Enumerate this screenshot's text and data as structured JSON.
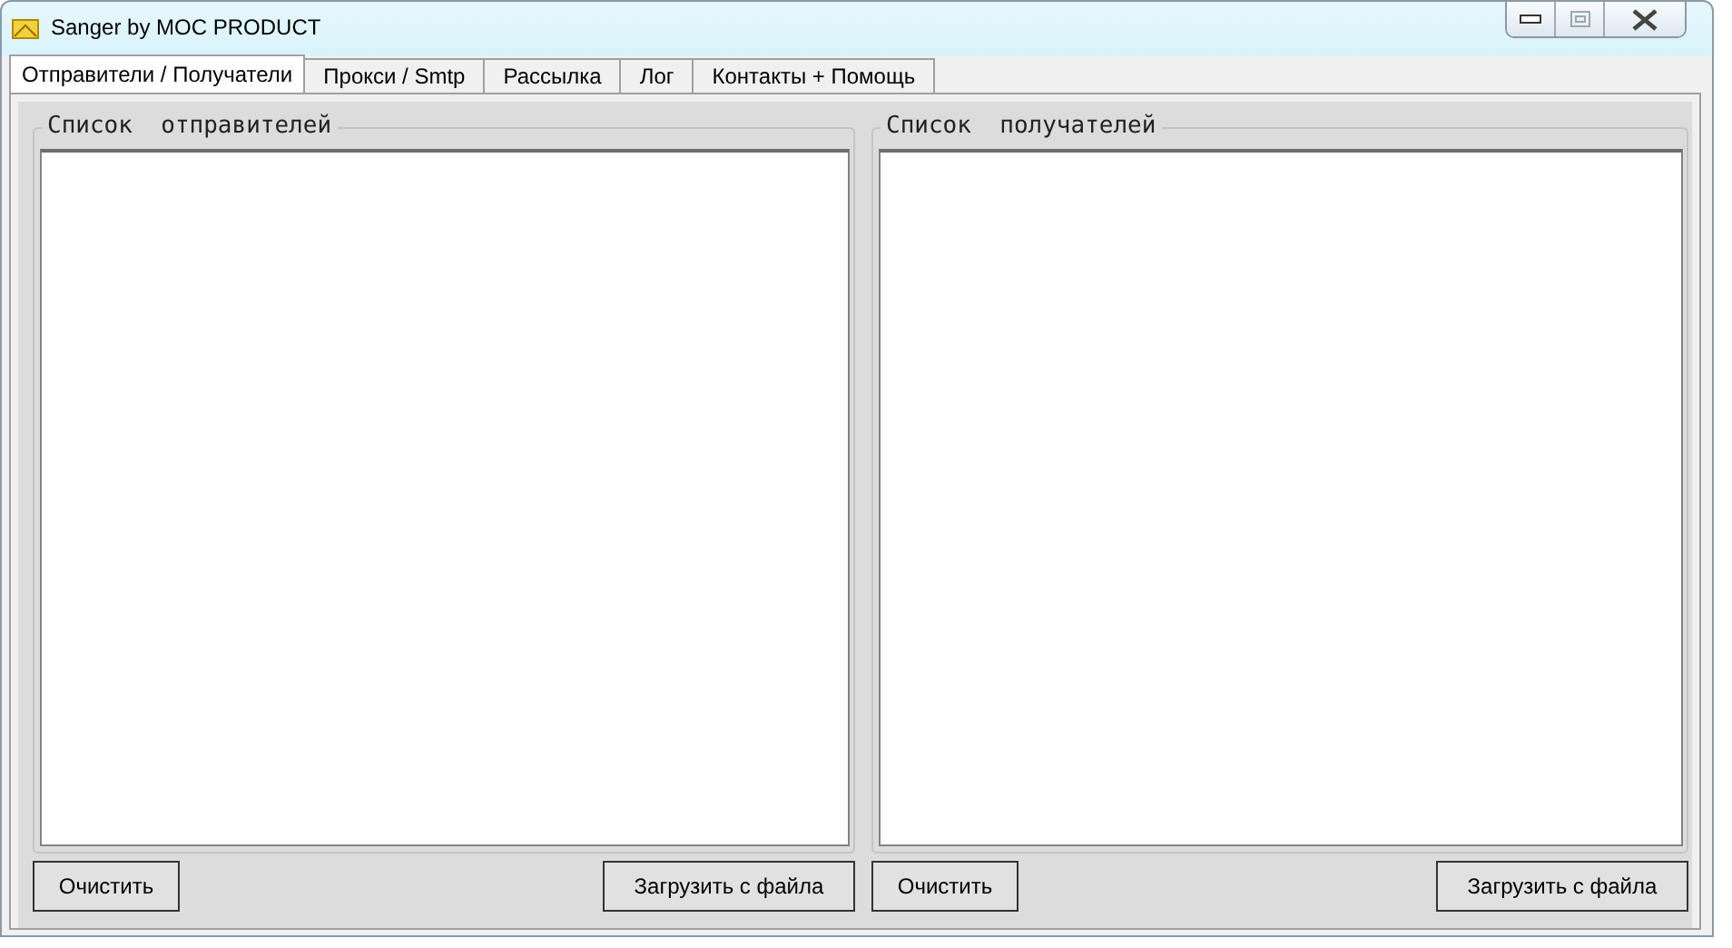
{
  "window": {
    "title": "Sanger by MOC PRODUCT"
  },
  "tabs": [
    {
      "label": "Отправители / Получатели",
      "selected": true
    },
    {
      "label": "Прокси / Smtp",
      "selected": false
    },
    {
      "label": "Рассылка",
      "selected": false
    },
    {
      "label": "Лог",
      "selected": false
    },
    {
      "label": "Контакты + Помощь",
      "selected": false
    }
  ],
  "panels": [
    {
      "title": "Список  отправителей",
      "buttons": [
        "Очистить",
        "Загрузить с файла"
      ]
    },
    {
      "title": "Список  получателей",
      "buttons": [
        "Очистить",
        "Загрузить с файла"
      ]
    }
  ]
}
